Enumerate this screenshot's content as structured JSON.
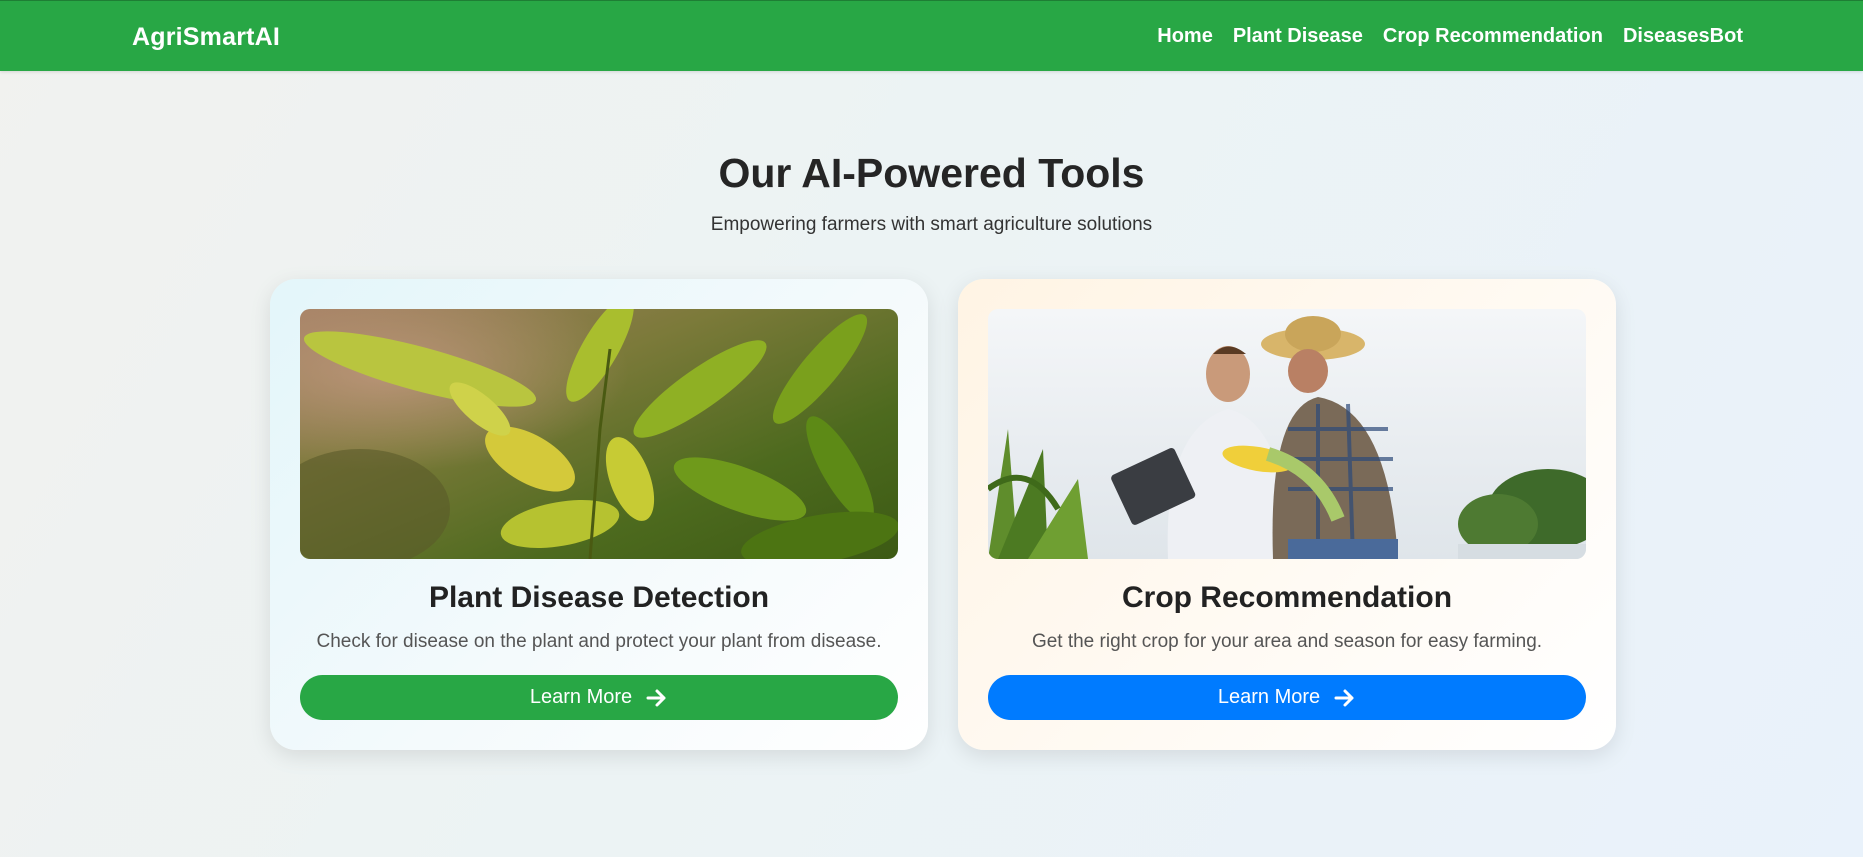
{
  "nav": {
    "brand": "AgriSmartAI",
    "links": [
      "Home",
      "Plant Disease",
      "Crop Recommendation",
      "DiseasesBot"
    ]
  },
  "hero": {
    "title": "Our AI-Powered Tools",
    "subtitle": "Empowering farmers with smart agriculture solutions"
  },
  "cards": [
    {
      "title": "Plant Disease Detection",
      "description": "Check for disease on the plant and protect your plant from disease.",
      "button_label": "Learn More",
      "button_color": "#28a745",
      "image": "plant-leaves-photo"
    },
    {
      "title": "Crop Recommendation",
      "description": "Get the right crop for your area and season for easy farming.",
      "button_label": "Learn More",
      "button_color": "#007bff",
      "image": "farmers-with-tablet-photo"
    }
  ],
  "colors": {
    "nav_bg": "#28a745",
    "primary_green": "#28a745",
    "primary_blue": "#007bff"
  }
}
